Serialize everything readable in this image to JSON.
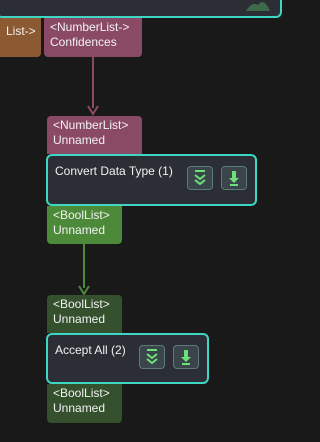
{
  "top_ports": {
    "left_label": "List->",
    "right_type": "<NumberList->",
    "right_name": "Confidences"
  },
  "convert_node": {
    "input_type": "<NumberList>",
    "input_name": "Unnamed",
    "title": "Convert Data Type (1)",
    "output_type": "<BoolList>",
    "output_name": "Unnamed"
  },
  "accept_node": {
    "input_type": "<BoolList>",
    "input_name": "Unnamed",
    "title": "Accept All (2)",
    "output_type": "<BoolList>",
    "output_name": "Unnamed"
  },
  "colors": {
    "background": "#191919",
    "node_border": "#3fd6c4",
    "number_port": "#8a4a66",
    "bool_port_active": "#4c8a3a",
    "bool_port": "#34502d",
    "list_port": "#8c5a32",
    "icon_green": "#6ee07a"
  },
  "icons": [
    "expand-down-icon",
    "download-icon",
    "tree-icon"
  ]
}
